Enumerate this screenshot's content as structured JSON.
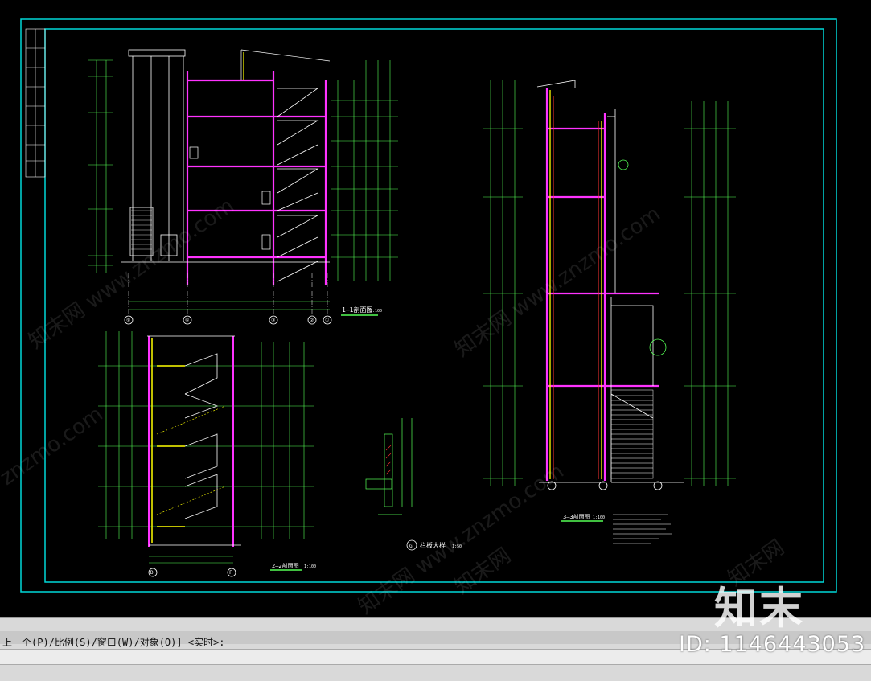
{
  "drawing": {
    "section_titles": {
      "s1": "1—1剖面图",
      "s2": "2—2剖面图",
      "s3": "3—3剖面图",
      "detail": "栏板大样"
    },
    "scales": {
      "s1": "1:100",
      "s2": "1:100",
      "s3": "1:100",
      "detail": "1:50"
    },
    "detail_marker": "G",
    "axis_labels_s1": [
      "⑨",
      "⑥",
      "③",
      "②",
      "①"
    ],
    "axis_labels_s2": [
      "D",
      "F"
    ],
    "colors": {
      "frame": "#00d8d8",
      "wall": "#ff33ff",
      "dimension": "#55ff55",
      "axis": "#ffffff",
      "accent": "#ffff00",
      "watermark": "#ffffff"
    }
  },
  "command_line": {
    "prompt": "上一个(P)/比例(S)/窗口(W)/对象(O)] <实时>:"
  },
  "watermarks": {
    "logo": "知末",
    "diag": [
      "知末网 www.znzmo.com",
      "znzmo.com",
      "知末网 www.znzmo.com",
      "知末网 www.znzmo.com",
      "知末网",
      "知末网"
    ],
    "id_text": "ID: 1146443053"
  }
}
